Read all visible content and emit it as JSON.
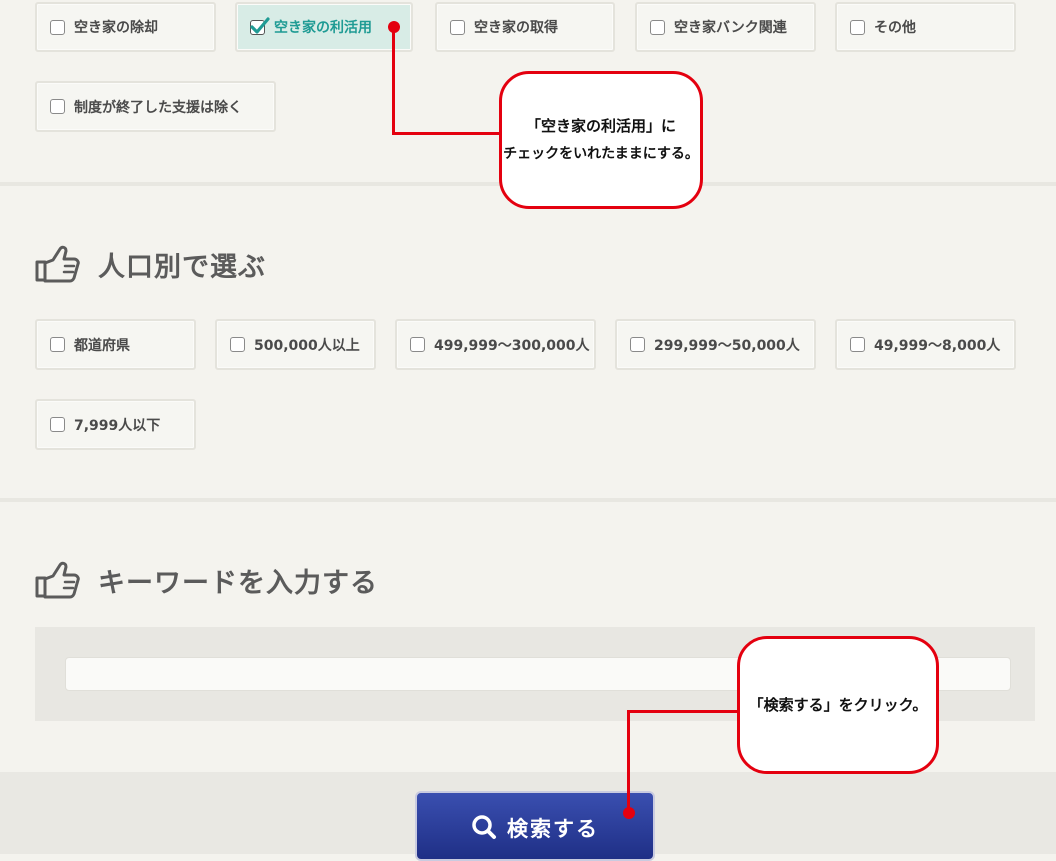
{
  "purpose_filters": {
    "options": [
      {
        "label": "空き家の除却",
        "checked": false
      },
      {
        "label": "空き家の利活用",
        "checked": true
      },
      {
        "label": "空き家の取得",
        "checked": false
      },
      {
        "label": "空き家バンク関連",
        "checked": false
      },
      {
        "label": "その他",
        "checked": false
      },
      {
        "label": "制度が終了した支援は除く",
        "checked": false
      }
    ]
  },
  "population_section": {
    "heading": "人口別で選ぶ",
    "options": [
      {
        "label": "都道府県",
        "checked": false
      },
      {
        "label": "500,000人以上",
        "checked": false
      },
      {
        "label": "499,999～300,000人",
        "checked": false
      },
      {
        "label": "299,999～50,000人",
        "checked": false
      },
      {
        "label": "49,999～8,000人",
        "checked": false
      },
      {
        "label": "7,999人以下",
        "checked": false
      }
    ]
  },
  "keyword_section": {
    "heading": "キーワードを入力する",
    "input_value": "",
    "input_placeholder": ""
  },
  "search_button": {
    "label": "検索する"
  },
  "callouts": {
    "checkbox_note_line1": "「空き家の利活用」に",
    "checkbox_note_line2": "チェックをいれたままにする。",
    "search_note": "「検索する」をクリック。"
  },
  "colors": {
    "accent_red": "#e4000f",
    "checked_text": "#1f9b94",
    "button_blue": "#2a3f9a"
  }
}
